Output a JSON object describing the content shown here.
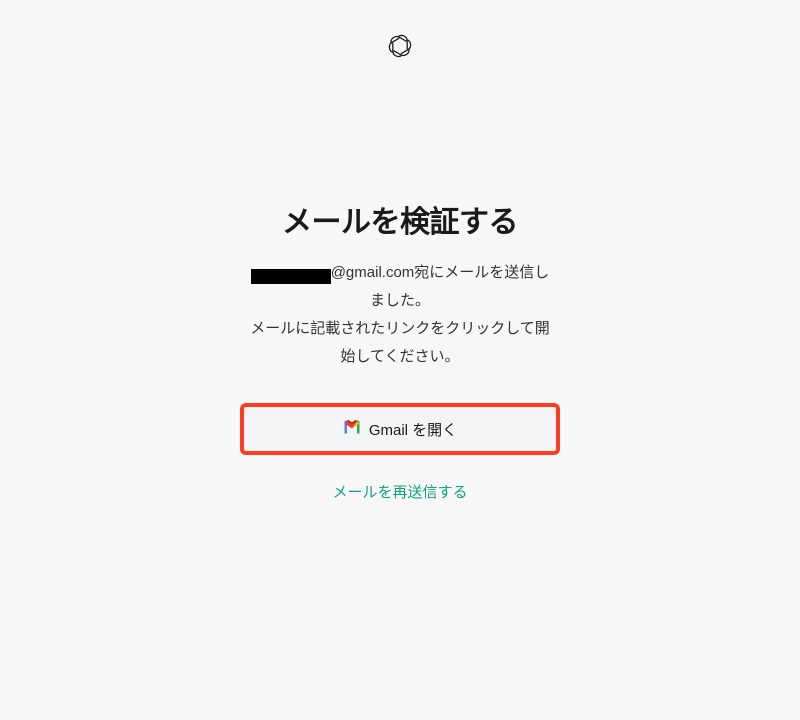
{
  "header": {
    "logo_name": "openai-logo"
  },
  "verify": {
    "title": "メールを検証する",
    "email_domain": "@gmail.com",
    "sent_suffix_line1": " 宛にメールを送信し",
    "sent_suffix_line2": "ました。",
    "instruction_line1": "メールに記載されたリンクをクリックして開",
    "instruction_line2": "始してください。",
    "open_gmail_label": "Gmail を開く",
    "resend_label": "メールを再送信する"
  }
}
